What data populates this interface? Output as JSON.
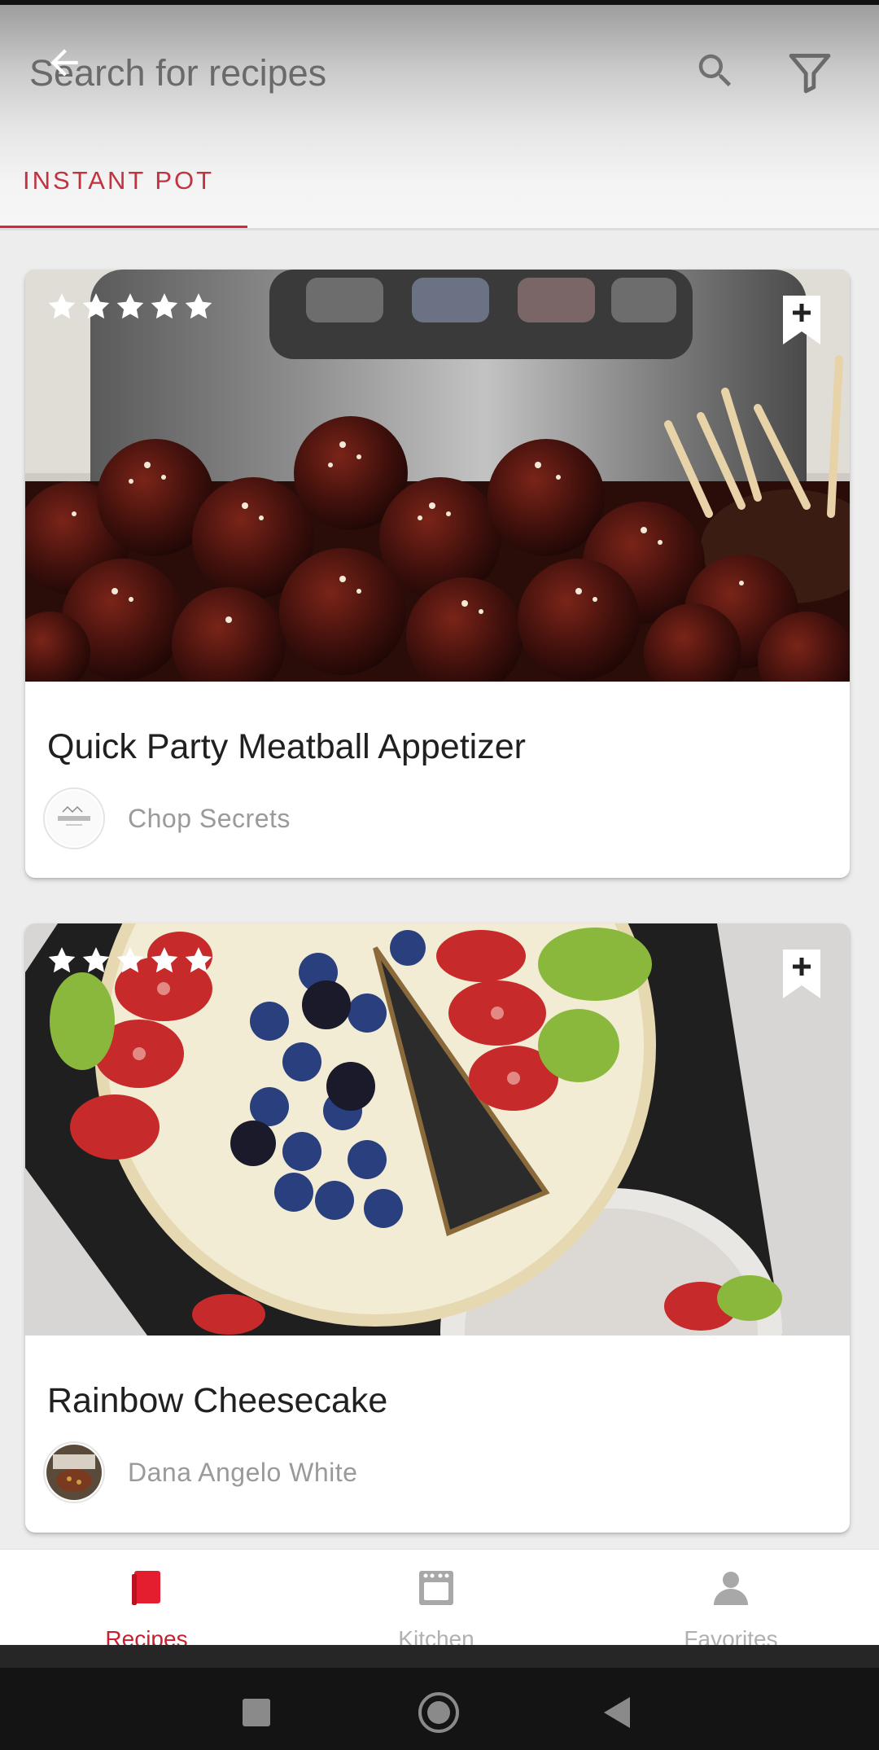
{
  "header": {
    "search_placeholder": "Search for recipes",
    "back_icon": "arrow-back-icon",
    "search_icon": "search-icon",
    "filter_icon": "filter-icon"
  },
  "tabs": [
    {
      "label": "INSTANT POT",
      "active": true
    }
  ],
  "recipes": [
    {
      "title": "Quick Party Meatball Appetizer",
      "author": "Chop Secrets",
      "rating": 5,
      "rating_max": 5,
      "bookmark_icon": "bookmark-add-icon"
    },
    {
      "title": "Rainbow Cheesecake",
      "author": "Dana Angelo White",
      "rating": 5,
      "rating_max": 5,
      "bookmark_icon": "bookmark-add-icon"
    }
  ],
  "bottom_nav": {
    "items": [
      {
        "label": "Recipes",
        "icon": "recipe-book-icon",
        "active": true
      },
      {
        "label": "Kitchen",
        "icon": "oven-icon",
        "active": false
      },
      {
        "label": "Favorites",
        "icon": "person-icon",
        "active": false
      }
    ]
  },
  "colors": {
    "accent": "#d6273a",
    "tab_text": "#c0333f",
    "inactive_nav": "#b0b0b0"
  }
}
